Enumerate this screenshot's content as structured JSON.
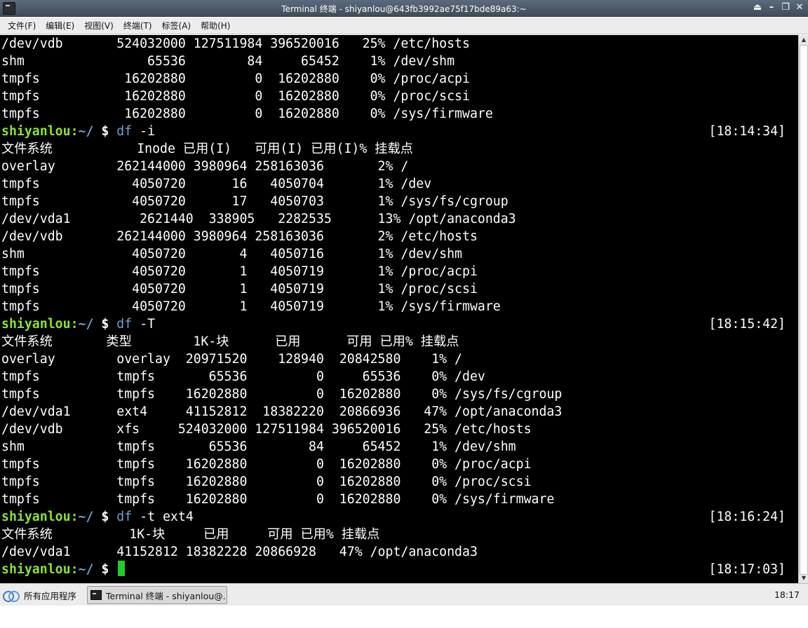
{
  "window": {
    "title": "Terminal 终端 - shiyanlou@643fb3992ae75f17bde89a63:~",
    "buttons": [
      "⏏",
      "–",
      "❐",
      "✕"
    ]
  },
  "menubar": {
    "items": [
      "文件(F)",
      "编辑(E)",
      "视图(V)",
      "终端(T)",
      "标签(A)",
      "帮助(H)"
    ]
  },
  "terminal": {
    "colors": {
      "user": "#8ae234",
      "path": "#729fcf",
      "cursor": "#22cc22",
      "bg": "#000000"
    },
    "lines": [
      {
        "type": "text",
        "text": "/dev/vdb       524032000 127511984 396520016   25% /etc/hosts"
      },
      {
        "type": "text",
        "text": "shm                65536        84     65452    1% /dev/shm"
      },
      {
        "type": "text",
        "text": "tmpfs           16202880         0  16202880    0% /proc/acpi"
      },
      {
        "type": "text",
        "text": "tmpfs           16202880         0  16202880    0% /proc/scsi"
      },
      {
        "type": "text",
        "text": "tmpfs           16202880         0  16202880    0% /sys/firmware"
      },
      {
        "type": "prompt",
        "user": "shiyanlou",
        "path": "~/",
        "symbol": "$",
        "cmd": "df",
        "args": " -i",
        "time": "[18:14:34]"
      },
      {
        "type": "text",
        "text": "文件系统           Inode 已用(I)   可用(I) 已用(I)% 挂载点"
      },
      {
        "type": "text",
        "text": "overlay        262144000 3980964 258163036       2% /"
      },
      {
        "type": "text",
        "text": "tmpfs            4050720      16   4050704       1% /dev"
      },
      {
        "type": "text",
        "text": "tmpfs            4050720      17   4050703       1% /sys/fs/cgroup"
      },
      {
        "type": "text",
        "text": "/dev/vda1         2621440  338905   2282535      13% /opt/anaconda3"
      },
      {
        "type": "text",
        "text": "/dev/vdb       262144000 3980964 258163036       2% /etc/hosts"
      },
      {
        "type": "text",
        "text": "shm              4050720       4   4050716       1% /dev/shm"
      },
      {
        "type": "text",
        "text": "tmpfs            4050720       1   4050719       1% /proc/acpi"
      },
      {
        "type": "text",
        "text": "tmpfs            4050720       1   4050719       1% /proc/scsi"
      },
      {
        "type": "text",
        "text": "tmpfs            4050720       1   4050719       1% /sys/firmware"
      },
      {
        "type": "prompt",
        "user": "shiyanlou",
        "path": "~/",
        "symbol": "$",
        "cmd": "df",
        "args": " -T",
        "time": "[18:15:42]"
      },
      {
        "type": "text",
        "text": "文件系统       类型        1K-块      已用      可用 已用% 挂载点"
      },
      {
        "type": "text",
        "text": "overlay        overlay  20971520    128940  20842580    1% /"
      },
      {
        "type": "text",
        "text": "tmpfs          tmpfs       65536         0     65536    0% /dev"
      },
      {
        "type": "text",
        "text": "tmpfs          tmpfs    16202880         0  16202880    0% /sys/fs/cgroup"
      },
      {
        "type": "text",
        "text": "/dev/vda1      ext4     41152812  18382220  20866936   47% /opt/anaconda3"
      },
      {
        "type": "text",
        "text": "/dev/vdb       xfs     524032000 127511984 396520016   25% /etc/hosts"
      },
      {
        "type": "text",
        "text": "shm            tmpfs       65536        84     65452    1% /dev/shm"
      },
      {
        "type": "text",
        "text": "tmpfs          tmpfs    16202880         0  16202880    0% /proc/acpi"
      },
      {
        "type": "text",
        "text": "tmpfs          tmpfs    16202880         0  16202880    0% /proc/scsi"
      },
      {
        "type": "text",
        "text": "tmpfs          tmpfs    16202880         0  16202880    0% /sys/firmware"
      },
      {
        "type": "prompt",
        "user": "shiyanlou",
        "path": "~/",
        "symbol": "$",
        "cmd": "df",
        "args": " -t ext4",
        "time": "[18:16:24]"
      },
      {
        "type": "text",
        "text": "文件系统          1K-块     已用     可用 已用% 挂载点"
      },
      {
        "type": "text",
        "text": "/dev/vda1      41152812 18382228 20866928   47% /opt/anaconda3"
      },
      {
        "type": "prompt",
        "user": "shiyanlou",
        "path": "~/",
        "symbol": "$",
        "cmd": "",
        "args": "",
        "time": "[18:17:03]",
        "cursor": true
      }
    ]
  },
  "taskbar": {
    "start_label": "所有应用程序",
    "task_label": "Terminal 终端 - shiyanlou@…",
    "clock": "18:17"
  }
}
